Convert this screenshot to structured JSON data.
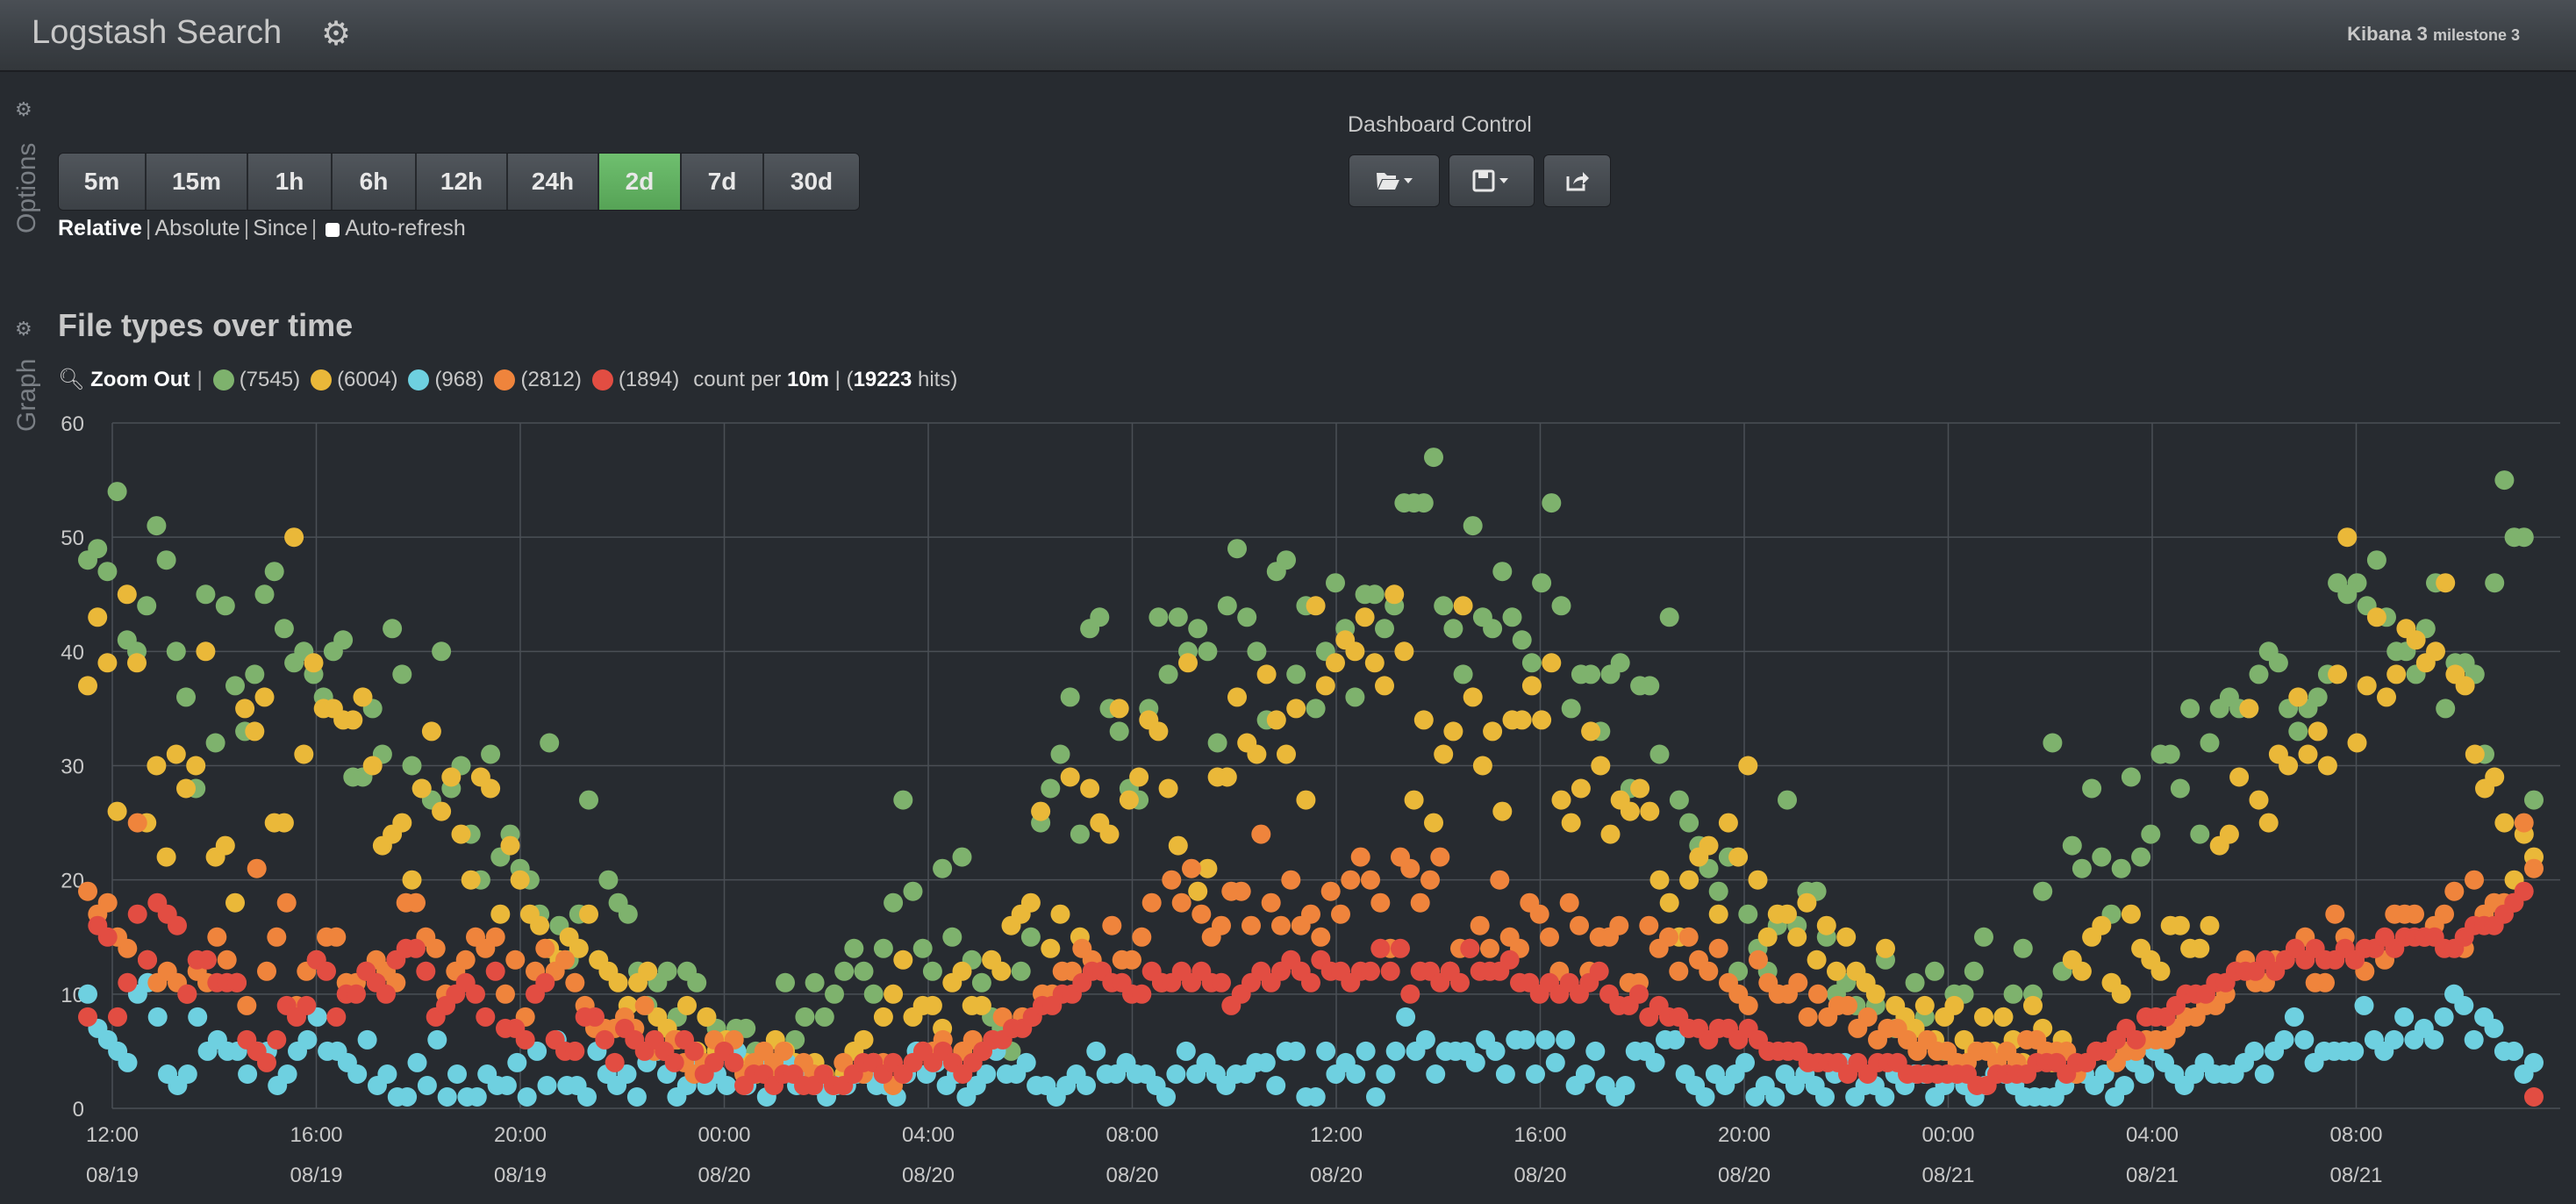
{
  "app": {
    "title": "Logstash Search",
    "version": "Kibana 3",
    "version_suffix": "milestone 3"
  },
  "side_labels": {
    "options": "Options",
    "graph": "Graph"
  },
  "timepicker": {
    "buttons": [
      "5m",
      "15m",
      "1h",
      "6h",
      "12h",
      "24h",
      "2d",
      "7d",
      "30d"
    ],
    "active": "2d",
    "modes": {
      "relative": "Relative",
      "absolute": "Absolute",
      "since": "Since"
    },
    "auto_refresh": "Auto-refresh"
  },
  "dashboard_control": {
    "title": "Dashboard Control"
  },
  "panel": {
    "title": "File types over time",
    "zoom_out": "Zoom Out",
    "count_prefix": "count per",
    "interval": "10m",
    "hits": "19223",
    "hits_suffix": "hits)"
  },
  "colors": {
    "green": "#7eb26d",
    "yellow": "#eab839",
    "blue": "#6ed0e0",
    "orange": "#ef843c",
    "red": "#e24d42",
    "active_button": "#62b162"
  },
  "chart_data": {
    "type": "scatter",
    "ylim": [
      0,
      60
    ],
    "yticks": [
      0,
      10,
      20,
      30,
      40,
      50,
      60
    ],
    "xticks": [
      {
        "time": "12:00",
        "date": "08/19"
      },
      {
        "time": "16:00",
        "date": "08/19"
      },
      {
        "time": "20:00",
        "date": "08/19"
      },
      {
        "time": "00:00",
        "date": "08/20"
      },
      {
        "time": "04:00",
        "date": "08/20"
      },
      {
        "time": "08:00",
        "date": "08/20"
      },
      {
        "time": "12:00",
        "date": "08/20"
      },
      {
        "time": "16:00",
        "date": "08/20"
      },
      {
        "time": "20:00",
        "date": "08/20"
      },
      {
        "time": "00:00",
        "date": "08/21"
      },
      {
        "time": "04:00",
        "date": "08/21"
      },
      {
        "time": "08:00",
        "date": "08/21"
      }
    ],
    "grid": true,
    "series": [
      {
        "count": "(7545)",
        "color": "#7eb26d",
        "values": [
          48,
          49,
          47,
          54,
          41,
          40,
          44,
          51,
          48,
          40,
          36,
          28,
          45,
          32,
          44,
          37,
          33,
          38,
          45,
          47,
          42,
          39,
          40,
          38,
          36,
          40,
          41,
          29,
          29,
          35,
          31,
          42,
          38,
          30,
          28,
          27,
          40,
          28,
          30,
          24,
          20,
          31,
          22,
          24,
          21,
          20,
          17,
          32,
          16,
          13,
          17,
          27,
          13,
          20,
          18,
          17,
          12,
          9,
          11,
          12,
          8,
          12,
          11,
          8,
          7,
          6,
          7,
          7,
          5,
          4,
          3,
          11,
          6,
          8,
          11,
          8,
          10,
          12,
          14,
          12,
          10,
          14,
          18,
          27,
          19,
          14,
          12,
          21,
          15,
          22,
          13,
          11,
          8,
          7,
          5,
          12,
          15,
          25,
          28,
          31,
          36,
          24,
          42,
          43,
          35,
          33,
          28,
          27,
          35,
          43,
          38,
          43,
          40,
          42,
          40,
          32,
          44,
          49,
          43,
          40,
          34,
          47,
          48,
          38,
          44,
          35,
          40,
          46,
          42,
          36,
          45,
          45,
          42,
          44,
          53,
          53,
          53,
          57,
          44,
          42,
          38,
          51,
          43,
          42,
          47,
          43,
          41,
          39,
          46,
          53,
          44,
          35,
          38,
          38,
          33,
          38,
          39,
          28,
          37,
          37,
          31,
          43,
          27,
          25,
          23,
          21,
          19,
          22,
          12,
          17,
          14,
          12,
          16,
          27,
          16,
          19,
          19,
          15,
          10,
          11,
          9,
          11,
          9,
          13,
          7,
          8,
          11,
          8,
          12,
          5,
          10,
          10,
          12,
          15,
          5,
          8,
          10,
          14,
          10,
          19,
          32,
          12,
          23,
          21,
          28,
          22,
          17,
          21,
          29,
          22,
          24,
          31,
          31,
          28,
          35,
          24,
          32,
          35,
          36,
          35,
          35,
          38,
          40,
          39,
          35,
          33,
          35,
          36,
          38,
          46,
          45,
          46,
          44,
          48,
          43,
          40,
          40,
          38,
          42,
          46,
          35,
          39,
          39,
          38,
          31,
          46,
          55,
          50,
          50,
          27
        ]
      },
      {
        "count": "(6004)",
        "color": "#eab839",
        "values": [
          37,
          43,
          39,
          26,
          45,
          39,
          25,
          30,
          22,
          31,
          28,
          30,
          40,
          22,
          23,
          18,
          35,
          33,
          36,
          25,
          25,
          50,
          31,
          39,
          35,
          35,
          34,
          34,
          36,
          30,
          23,
          24,
          25,
          20,
          28,
          33,
          26,
          29,
          24,
          20,
          29,
          28,
          17,
          23,
          20,
          17,
          16,
          14,
          13,
          15,
          14,
          17,
          13,
          12,
          11,
          9,
          11,
          12,
          8,
          7,
          6,
          9,
          5,
          8,
          5,
          6,
          5,
          4,
          3,
          3,
          6,
          5,
          4,
          3,
          4,
          3,
          2,
          3,
          5,
          6,
          4,
          8,
          10,
          13,
          8,
          9,
          9,
          7,
          11,
          12,
          9,
          9,
          13,
          12,
          16,
          17,
          18,
          26,
          14,
          17,
          29,
          15,
          28,
          25,
          24,
          35,
          27,
          29,
          34,
          33,
          28,
          23,
          39,
          19,
          21,
          29,
          29,
          36,
          32,
          31,
          38,
          34,
          31,
          35,
          27,
          44,
          37,
          39,
          41,
          40,
          43,
          39,
          37,
          45,
          40,
          27,
          34,
          25,
          31,
          33,
          44,
          36,
          30,
          33,
          26,
          34,
          34,
          37,
          34,
          39,
          27,
          25,
          28,
          33,
          30,
          24,
          27,
          26,
          28,
          26,
          20,
          18,
          15,
          20,
          22,
          23,
          17,
          25,
          22,
          30,
          20,
          15,
          17,
          17,
          15,
          18,
          13,
          16,
          12,
          15,
          12,
          11,
          10,
          14,
          9,
          8,
          7,
          9,
          6,
          8,
          9,
          6,
          5,
          8,
          5,
          8,
          6,
          4,
          9,
          7,
          4,
          6,
          13,
          12,
          15,
          16,
          11,
          10,
          17,
          14,
          13,
          12,
          16,
          16,
          14,
          14,
          16,
          23,
          24,
          29,
          35,
          27,
          25,
          31,
          30,
          36,
          31,
          33,
          30,
          38,
          50,
          32,
          37,
          43,
          36,
          38,
          42,
          41,
          39,
          40,
          46,
          38,
          37,
          31,
          28,
          29,
          25,
          20,
          24,
          22
        ]
      },
      {
        "count": "(968)",
        "color": "#6ed0e0",
        "values": [
          10,
          7,
          6,
          5,
          4,
          10,
          11,
          8,
          3,
          2,
          3,
          8,
          5,
          6,
          5,
          5,
          3,
          5,
          5,
          2,
          3,
          5,
          6,
          8,
          5,
          5,
          4,
          3,
          6,
          2,
          3,
          1,
          1,
          4,
          2,
          6,
          1,
          3,
          1,
          1,
          3,
          2,
          2,
          4,
          1,
          5,
          2,
          6,
          2,
          2,
          1,
          5,
          3,
          2,
          3,
          1,
          4,
          5,
          3,
          1,
          2,
          4,
          2,
          3,
          2,
          5,
          2,
          4,
          1,
          4,
          4,
          2,
          3,
          2,
          1,
          2,
          2,
          3,
          3,
          2,
          2,
          1,
          3,
          5,
          3,
          4,
          2,
          3,
          1,
          2,
          3,
          5,
          3,
          3,
          4,
          2,
          2,
          1,
          2,
          3,
          2,
          5,
          3,
          3,
          4,
          3,
          3,
          2,
          1,
          3,
          5,
          3,
          4,
          3,
          2,
          3,
          3,
          4,
          4,
          2,
          5,
          5,
          1,
          1,
          5,
          3,
          4,
          3,
          5,
          1,
          3,
          5,
          8,
          5,
          6,
          3,
          5,
          5,
          5,
          4,
          6,
          5,
          3,
          6,
          6,
          3,
          6,
          4,
          6,
          2,
          3,
          5,
          2,
          1,
          2,
          5,
          5,
          4,
          6,
          6,
          3,
          2,
          1,
          3,
          2,
          3,
          4,
          1,
          2,
          1,
          3,
          2,
          3,
          2,
          1,
          3,
          4,
          1,
          2,
          2,
          1,
          3,
          2,
          3,
          3,
          1,
          2,
          3,
          2,
          1,
          2,
          3,
          3,
          2,
          1,
          1,
          1,
          1,
          2,
          3,
          3,
          2,
          3,
          1,
          2,
          4,
          3,
          5,
          4,
          3,
          2,
          3,
          4,
          3,
          3,
          3,
          4,
          5,
          3,
          5,
          6,
          8,
          6,
          4,
          5,
          5,
          5,
          5,
          9,
          6,
          5,
          6,
          8,
          6,
          7,
          6,
          8,
          10,
          9,
          6,
          8,
          7,
          5,
          5,
          3,
          4
        ]
      },
      {
        "count": "(2812)",
        "color": "#ef843c",
        "values": [
          19,
          17,
          18,
          15,
          14,
          25,
          13,
          11,
          12,
          11,
          10,
          12,
          11,
          15,
          13,
          11,
          9,
          21,
          12,
          15,
          18,
          9,
          12,
          13,
          15,
          15,
          11,
          11,
          12,
          13,
          12,
          11,
          18,
          18,
          15,
          14,
          10,
          12,
          13,
          15,
          14,
          15,
          10,
          13,
          8,
          12,
          14,
          12,
          13,
          11,
          9,
          7,
          7,
          7,
          8,
          7,
          9,
          5,
          5,
          6,
          4,
          3,
          4,
          6,
          5,
          6,
          3,
          4,
          5,
          4,
          5,
          3,
          4,
          3,
          3,
          2,
          4,
          3,
          3,
          4,
          4,
          2,
          3,
          4,
          5,
          5,
          6,
          4,
          5,
          6,
          5,
          6,
          8,
          7,
          8,
          8,
          10,
          10,
          12,
          12,
          14,
          13,
          12,
          16,
          13,
          13,
          15,
          18,
          11,
          20,
          18,
          21,
          17,
          15,
          16,
          19,
          19,
          16,
          24,
          18,
          16,
          20,
          16,
          17,
          15,
          19,
          17,
          20,
          22,
          20,
          18,
          14,
          22,
          21,
          18,
          20,
          22,
          12,
          14,
          14,
          16,
          14,
          20,
          15,
          14,
          18,
          17,
          15,
          12,
          18,
          16,
          12,
          15,
          15,
          16,
          11,
          11,
          16,
          14,
          15,
          12,
          15,
          13,
          12,
          14,
          11,
          10,
          9,
          13,
          11,
          10,
          10,
          11,
          8,
          10,
          8,
          9,
          9,
          7,
          8,
          6,
          7,
          7,
          6,
          5,
          6,
          5,
          5,
          4,
          4,
          5,
          5,
          4,
          5,
          4,
          6,
          6,
          5,
          5,
          5,
          3,
          4,
          5,
          5,
          4,
          5,
          5,
          6,
          6,
          6,
          7,
          8,
          8,
          9,
          9,
          10,
          12,
          13,
          11,
          11,
          13,
          13,
          14,
          15,
          11,
          11,
          17,
          15,
          13,
          12,
          14,
          13,
          17,
          17,
          17,
          15,
          16,
          17,
          19,
          14,
          20,
          17,
          18,
          18,
          18,
          25,
          21
        ]
      },
      {
        "count": "(1894)",
        "color": "#e24d42",
        "values": [
          8,
          16,
          15,
          8,
          11,
          17,
          13,
          18,
          17,
          16,
          10,
          13,
          13,
          11,
          11,
          11,
          6,
          5,
          4,
          6,
          9,
          8,
          9,
          13,
          12,
          8,
          10,
          10,
          12,
          11,
          10,
          13,
          14,
          14,
          12,
          8,
          9,
          10,
          11,
          10,
          8,
          12,
          7,
          7,
          6,
          10,
          11,
          6,
          5,
          5,
          8,
          8,
          6,
          4,
          7,
          6,
          5,
          6,
          5,
          4,
          6,
          5,
          3,
          4,
          5,
          4,
          2,
          3,
          3,
          2,
          3,
          3,
          2,
          2,
          3,
          2,
          2,
          3,
          4,
          4,
          3,
          4,
          3,
          4,
          5,
          4,
          5,
          4,
          3,
          4,
          5,
          6,
          6,
          7,
          7,
          8,
          9,
          9,
          10,
          10,
          11,
          12,
          12,
          11,
          11,
          10,
          10,
          12,
          11,
          11,
          12,
          11,
          12,
          11,
          11,
          9,
          10,
          11,
          12,
          11,
          12,
          13,
          12,
          11,
          13,
          12,
          12,
          11,
          12,
          12,
          14,
          12,
          14,
          10,
          12,
          12,
          11,
          12,
          11,
          14,
          12,
          12,
          12,
          13,
          11,
          11,
          10,
          11,
          10,
          11,
          10,
          11,
          12,
          10,
          9,
          9,
          10,
          8,
          9,
          8,
          8,
          7,
          7,
          6,
          7,
          7,
          6,
          7,
          6,
          5,
          5,
          5,
          5,
          4,
          4,
          4,
          4,
          3,
          4,
          3,
          4,
          4,
          4,
          3,
          3,
          3,
          3,
          3,
          3,
          3,
          2,
          2,
          3,
          3,
          3,
          3,
          4,
          4,
          4,
          3,
          4,
          4,
          5,
          5,
          6,
          7,
          6,
          8,
          8,
          8,
          9,
          10,
          10,
          10,
          11,
          11,
          12,
          12,
          12,
          13,
          12,
          13,
          14,
          13,
          14,
          13,
          13,
          14,
          13,
          14,
          14,
          15,
          14,
          15,
          15,
          15,
          15,
          14,
          14,
          15,
          16,
          16,
          16,
          17,
          18,
          19,
          1
        ]
      }
    ]
  }
}
